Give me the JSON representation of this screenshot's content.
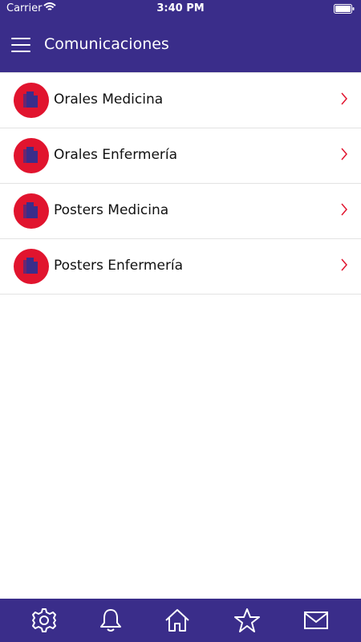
{
  "status": {
    "carrier": "Carrier",
    "time": "3:40 PM"
  },
  "header": {
    "title": "Comunicaciones"
  },
  "items": [
    {
      "label": "Orales Medicina"
    },
    {
      "label": "Orales Enfermería"
    },
    {
      "label": "Posters Medicina"
    },
    {
      "label": "Posters Enfermería"
    }
  ],
  "colors": {
    "primary": "#3a2d8a",
    "accent": "#e1142e"
  },
  "bottom_nav": [
    {
      "icon": "gear-icon"
    },
    {
      "icon": "bell-icon"
    },
    {
      "icon": "home-icon"
    },
    {
      "icon": "star-icon"
    },
    {
      "icon": "mail-icon"
    }
  ]
}
